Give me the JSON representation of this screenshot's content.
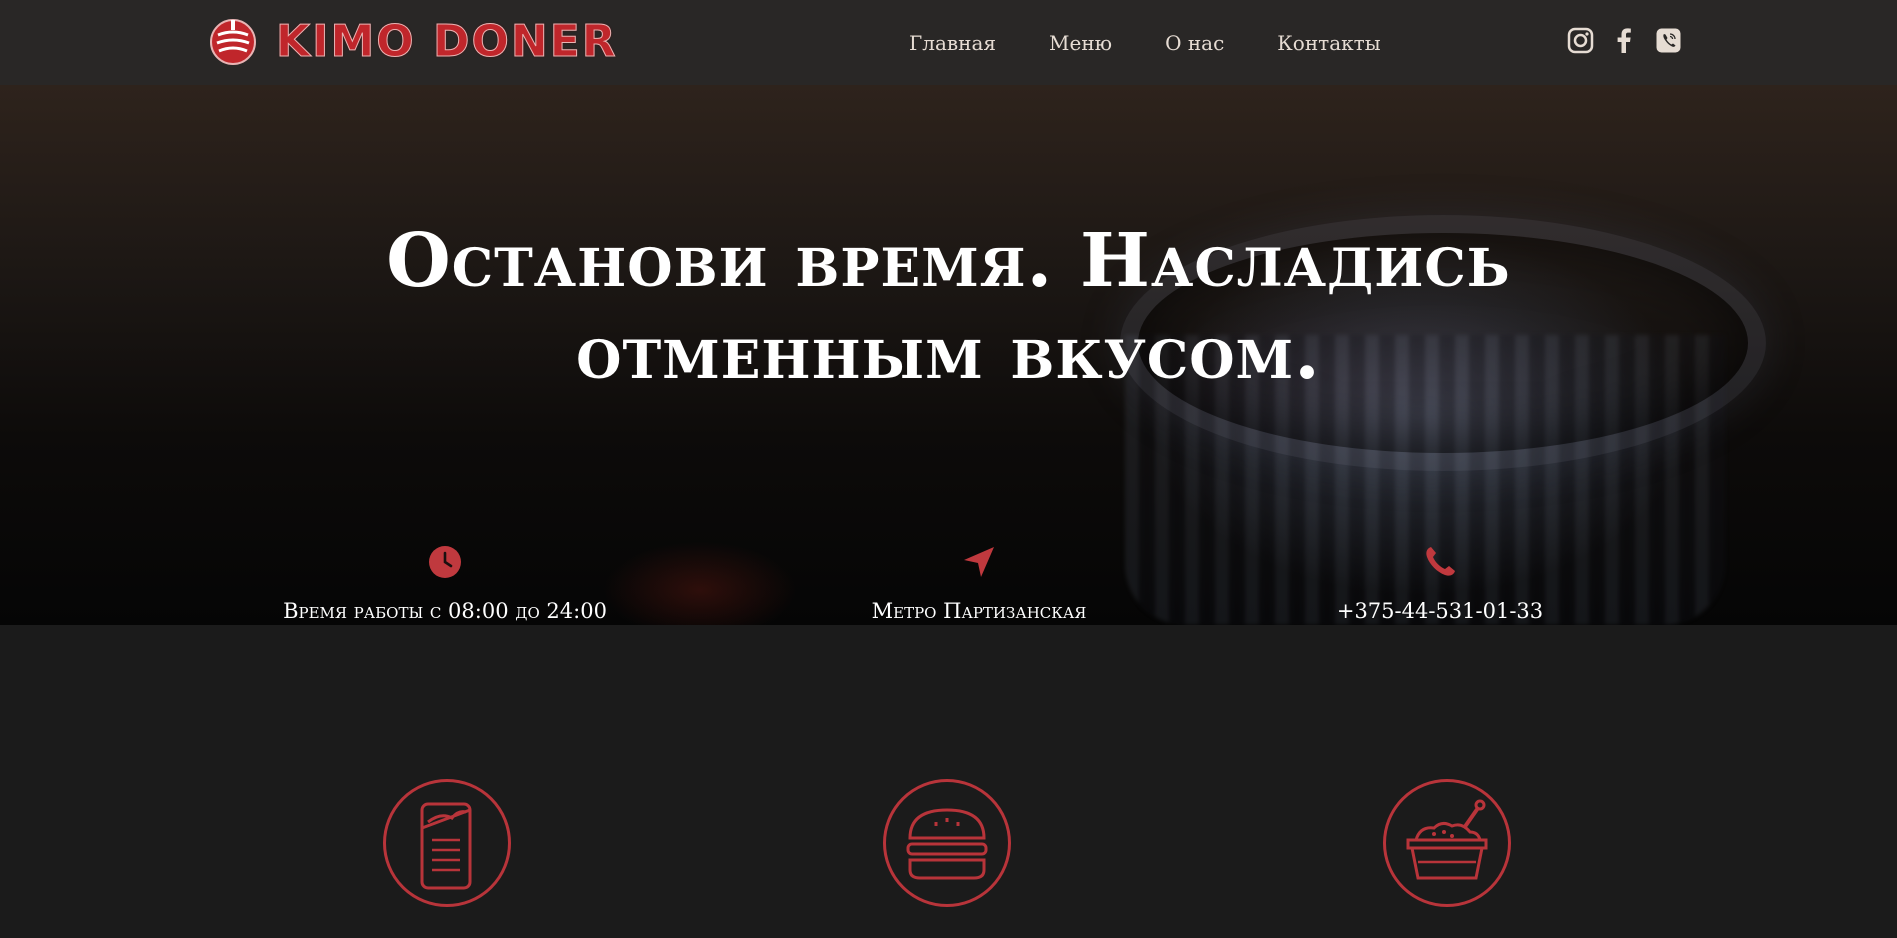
{
  "header": {
    "logo_text": "KIMO DONER",
    "nav": [
      "Главная",
      "Меню",
      "О нас",
      "Контакты"
    ],
    "social": [
      "instagram-icon",
      "facebook-icon",
      "viber-icon"
    ]
  },
  "hero": {
    "headline_line1": "Останови время. Насладись",
    "headline_line2": "отменным вкусом.",
    "info": [
      {
        "icon": "clock-icon",
        "text": "Время работы с 08:00 до 24:00"
      },
      {
        "icon": "location-arrow-icon",
        "text": "Метро Партизанская"
      },
      {
        "icon": "phone-icon",
        "text": "+375-44-531-01-33"
      }
    ]
  },
  "features": [
    "doner-wrap-icon",
    "burger-icon",
    "food-bowl-icon"
  ],
  "colors": {
    "accent": "#c0393e",
    "header_bg": "#292726",
    "page_bg": "#1b1b1b"
  }
}
